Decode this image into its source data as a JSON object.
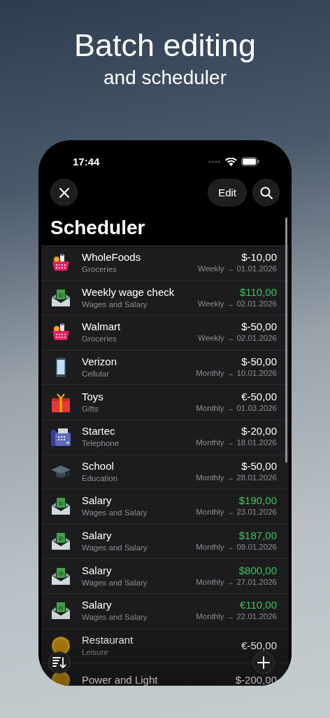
{
  "headline": {
    "title": "Batch editing",
    "subtitle": "and scheduler"
  },
  "status_bar": {
    "time": "17:44"
  },
  "toolbar": {
    "edit_label": "Edit"
  },
  "title": "Scheduler",
  "transactions": [
    {
      "kind": "groceries",
      "name": "WholeFoods",
      "category": "Groceries",
      "amount": "$-10,00",
      "income": false,
      "schedule": "Weekly → 01.01.2026"
    },
    {
      "kind": "money",
      "name": "Weekly wage check",
      "category": "Wages and Salary",
      "amount": "$110,00",
      "income": true,
      "schedule": "Weekly → 02.01.2026"
    },
    {
      "kind": "groceries",
      "name": "Walmart",
      "category": "Groceries",
      "amount": "$-50,00",
      "income": false,
      "schedule": "Weekly → 02.01.2026"
    },
    {
      "kind": "phone",
      "name": "Verizon",
      "category": "Cellular",
      "amount": "$-50,00",
      "income": false,
      "schedule": "Monthly → 10.01.2026"
    },
    {
      "kind": "gift",
      "name": "Toys",
      "category": "Gifts",
      "amount": "€-50,00",
      "income": false,
      "schedule": "Monthly → 01.03.2026"
    },
    {
      "kind": "telephone",
      "name": "Startec",
      "category": "Telephone",
      "amount": "$-20,00",
      "income": false,
      "schedule": "Monthly → 18.01.2026"
    },
    {
      "kind": "education",
      "name": "School",
      "category": "Education",
      "amount": "$-50,00",
      "income": false,
      "schedule": "Monthly → 28.01.2026"
    },
    {
      "kind": "money",
      "name": "Salary",
      "category": "Wages and Salary",
      "amount": "$190,00",
      "income": true,
      "schedule": "Monthly → 23.01.2026"
    },
    {
      "kind": "money",
      "name": "Salary",
      "category": "Wages and Salary",
      "amount": "$187,00",
      "income": true,
      "schedule": "Monthly → 09.01.2026"
    },
    {
      "kind": "money",
      "name": "Salary",
      "category": "Wages and Salary",
      "amount": "$800,00",
      "income": true,
      "schedule": "Monthly → 27.01.2026"
    },
    {
      "kind": "money",
      "name": "Salary",
      "category": "Wages and Salary",
      "amount": "€110,00",
      "income": true,
      "schedule": "Monthly → 22.01.2026"
    },
    {
      "kind": "coin",
      "name": "Restaurant",
      "category": "Leisure",
      "amount": "€-50,00",
      "income": false
    },
    {
      "kind": "coin",
      "name": "Power and Light",
      "amount": "$-200,00",
      "income": false
    }
  ]
}
